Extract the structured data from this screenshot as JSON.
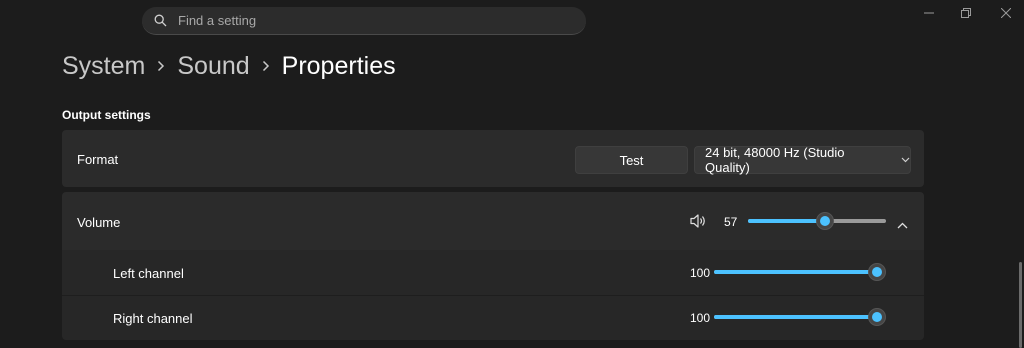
{
  "search": {
    "placeholder": "Find a setting",
    "icon": "search-icon"
  },
  "window_controls": [
    "minimize-icon",
    "restore-icon",
    "close-icon"
  ],
  "breadcrumb": {
    "items": [
      "System",
      "Sound",
      "Properties"
    ]
  },
  "output_settings": {
    "title": "Output settings",
    "format": {
      "label": "Format",
      "test_label": "Test",
      "selected": "24 bit, 48000 Hz (Studio Quality)"
    },
    "volume": {
      "label": "Volume",
      "value": "57",
      "level": 0.57,
      "icon": "speaker-icon",
      "expanded": true
    },
    "left_channel": {
      "label": "Left channel",
      "value": "100",
      "level": 1.0
    },
    "right_channel": {
      "label": "Right channel",
      "value": "100",
      "level": 1.0
    }
  },
  "colors": {
    "accent": "#4cc2ff",
    "background": "#1c1c1c",
    "card": "#2b2b2b"
  }
}
